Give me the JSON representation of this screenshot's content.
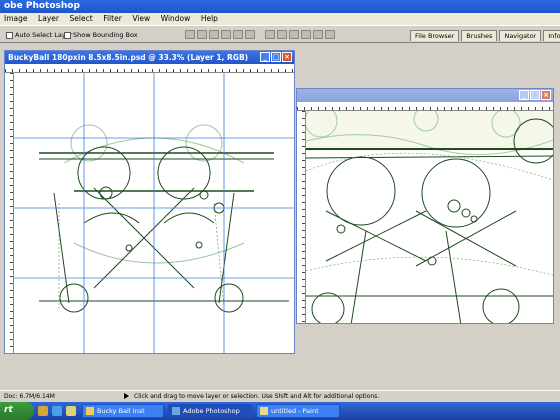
{
  "app": {
    "title": "obe Photoshop"
  },
  "menu": [
    "Image",
    "Layer",
    "Select",
    "Filter",
    "View",
    "Window",
    "Help"
  ],
  "options": {
    "auto_select": "Auto Select Layer",
    "bounding_box": "Show Bounding Box"
  },
  "palettes": [
    "File Browser",
    "Brushes",
    "Navigator",
    "Info"
  ],
  "doc1": {
    "title": "BuckyBall 180pxin 8.5x8.5in.psd @ 33.3% (Layer 1, RGB)",
    "min": "_",
    "max": "□",
    "close": "×"
  },
  "doc2": {
    "min": "_",
    "max": "□",
    "close": "×"
  },
  "status": {
    "doc": "Doc: 6.7M/6.14M",
    "hint": "Click and drag to move layer or selection. Use Shift and Alt for additional options."
  },
  "taskbar": {
    "start": "rt",
    "items": [
      "Bucky Ball Inst",
      "Adobe Photoshop",
      "untitled - Paint"
    ]
  },
  "colors": {
    "guide": "#3e7fd8",
    "art_dark": "#1f4a1f",
    "art_light": "#9cc59c"
  }
}
